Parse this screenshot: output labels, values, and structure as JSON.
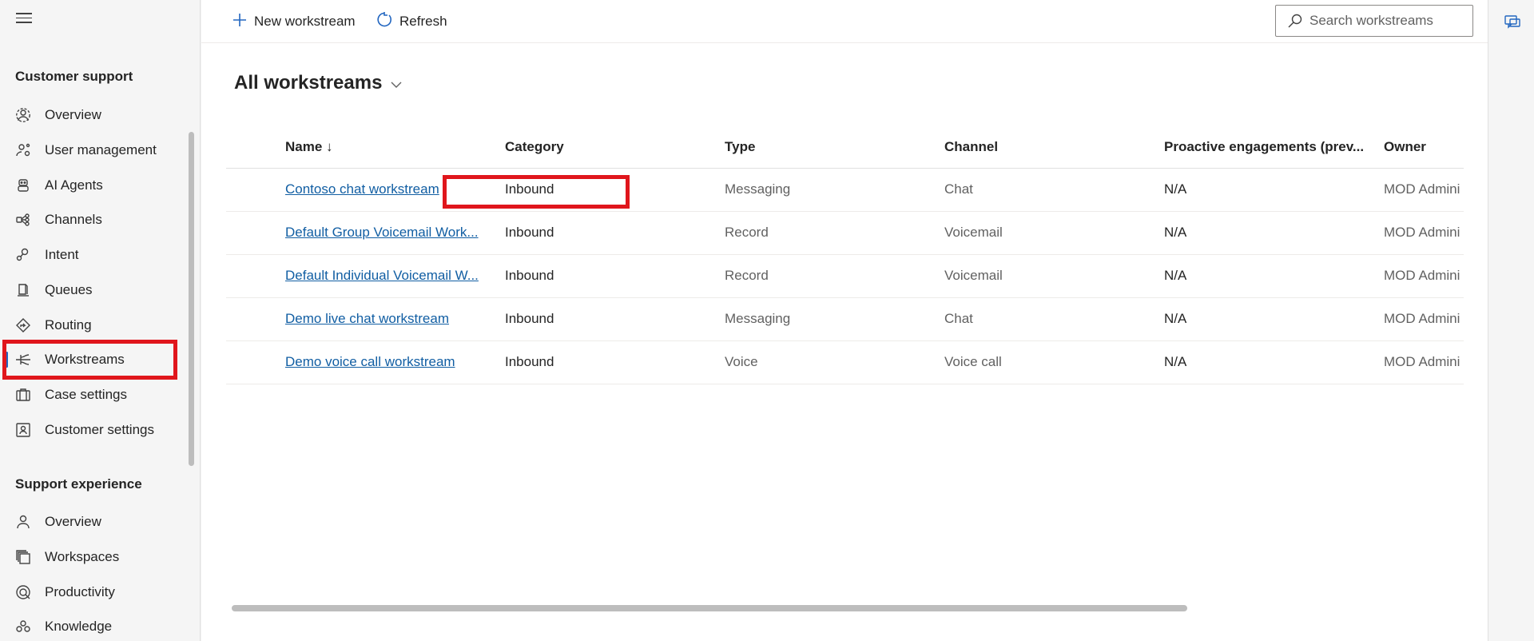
{
  "sidebar": {
    "customer_support_title": "Customer support",
    "support_experience_title": "Support experience",
    "customer_support_items": [
      {
        "label": "Overview",
        "icon": "settings-person-icon"
      },
      {
        "label": "User management",
        "icon": "people-settings-icon"
      },
      {
        "label": "AI Agents",
        "icon": "bot-icon"
      },
      {
        "label": "Channels",
        "icon": "channels-icon"
      },
      {
        "label": "Intent",
        "icon": "intent-icon"
      },
      {
        "label": "Queues",
        "icon": "queue-icon"
      },
      {
        "label": "Routing",
        "icon": "routing-icon"
      },
      {
        "label": "Workstreams",
        "icon": "workstream-icon"
      },
      {
        "label": "Case settings",
        "icon": "briefcase-icon"
      },
      {
        "label": "Customer settings",
        "icon": "contact-card-icon"
      }
    ],
    "support_experience_items": [
      {
        "label": "Overview",
        "icon": "person-icon"
      },
      {
        "label": "Workspaces",
        "icon": "workspaces-icon"
      },
      {
        "label": "Productivity",
        "icon": "productivity-icon"
      },
      {
        "label": "Knowledge",
        "icon": "knowledge-icon"
      }
    ],
    "selected": "Workstreams"
  },
  "toolbar": {
    "new_label": "New workstream",
    "refresh_label": "Refresh",
    "search_placeholder": "Search workstreams"
  },
  "view": {
    "title": "All workstreams"
  },
  "table": {
    "columns": [
      "Name ↓",
      "Category",
      "Type",
      "Channel",
      "Proactive engagements (prev...",
      "Owner"
    ],
    "rows": [
      [
        "Contoso chat workstream",
        "Inbound",
        "Messaging",
        "Chat",
        "N/A",
        "MOD Admini"
      ],
      [
        "Default Group Voicemail Work...",
        "Inbound",
        "Record",
        "Voicemail",
        "N/A",
        "MOD Admini"
      ],
      [
        "Default Individual Voicemail W...",
        "Inbound",
        "Record",
        "Voicemail",
        "N/A",
        "MOD Admini"
      ],
      [
        "Demo live chat workstream",
        "Inbound",
        "Messaging",
        "Chat",
        "N/A",
        "MOD Admini"
      ],
      [
        "Demo voice call workstream",
        "Inbound",
        "Voice",
        "Voice call",
        "N/A",
        "MOD Admini"
      ]
    ]
  },
  "colors": {
    "accent": "#2266c0",
    "link": "#115ea3",
    "highlight": "#e0161c"
  }
}
